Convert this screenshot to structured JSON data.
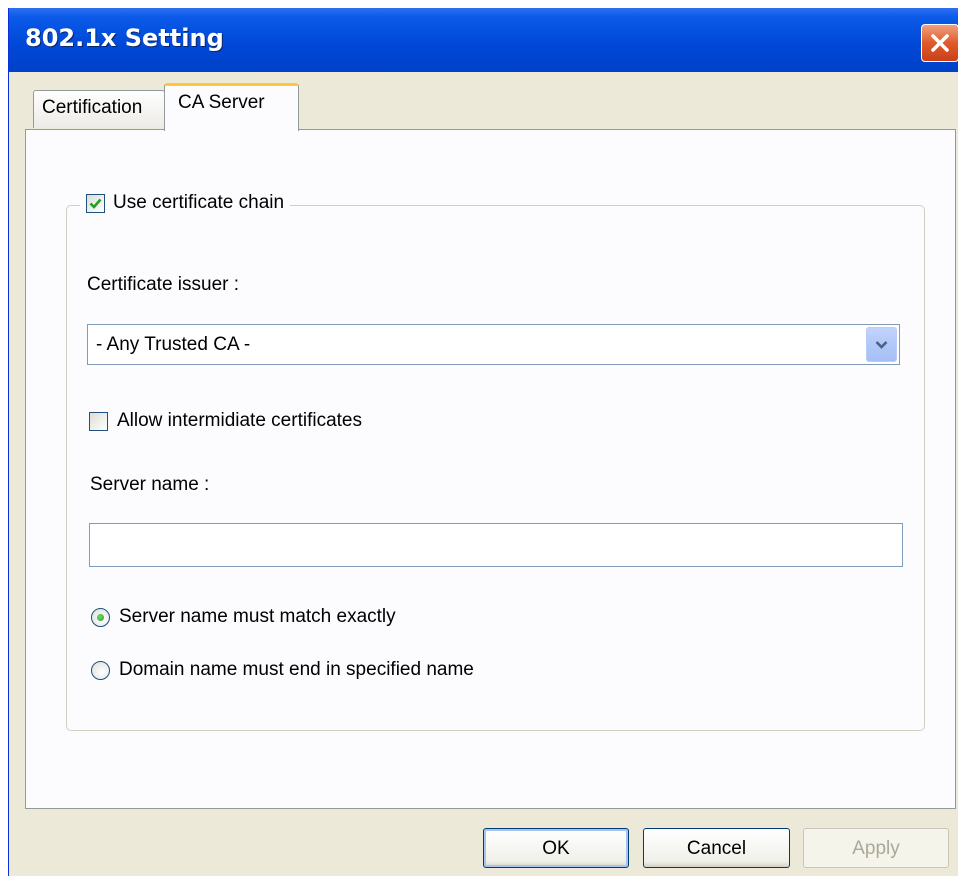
{
  "window": {
    "title": "802.1x Setting"
  },
  "tabs": [
    {
      "label": "Certification",
      "active": false
    },
    {
      "label": "CA Server",
      "active": true
    }
  ],
  "ca_server": {
    "use_chain": {
      "label": "Use certificate chain",
      "checked": true
    },
    "issuer_label": "Certificate issuer :",
    "issuer_select": {
      "value": "- Any Trusted CA -"
    },
    "allow_intermediate": {
      "label": "Allow intermidiate certificates",
      "checked": false
    },
    "server_name_label": "Server name :",
    "server_name_value": "",
    "radios": [
      {
        "label": "Server name must match exactly",
        "selected": true
      },
      {
        "label": "Domain name must end in specified name",
        "selected": false
      }
    ]
  },
  "buttons": {
    "ok": "OK",
    "cancel": "Cancel",
    "apply": "Apply"
  },
  "colors": {
    "titlebar": "#0047d6",
    "dialog_bg": "#ece9d8",
    "tab_highlight": "#ffc83c",
    "close": "#e05a2a"
  },
  "icons": {
    "close": "close-icon",
    "dropdown": "chevron-down-icon",
    "check": "checkmark-icon"
  }
}
